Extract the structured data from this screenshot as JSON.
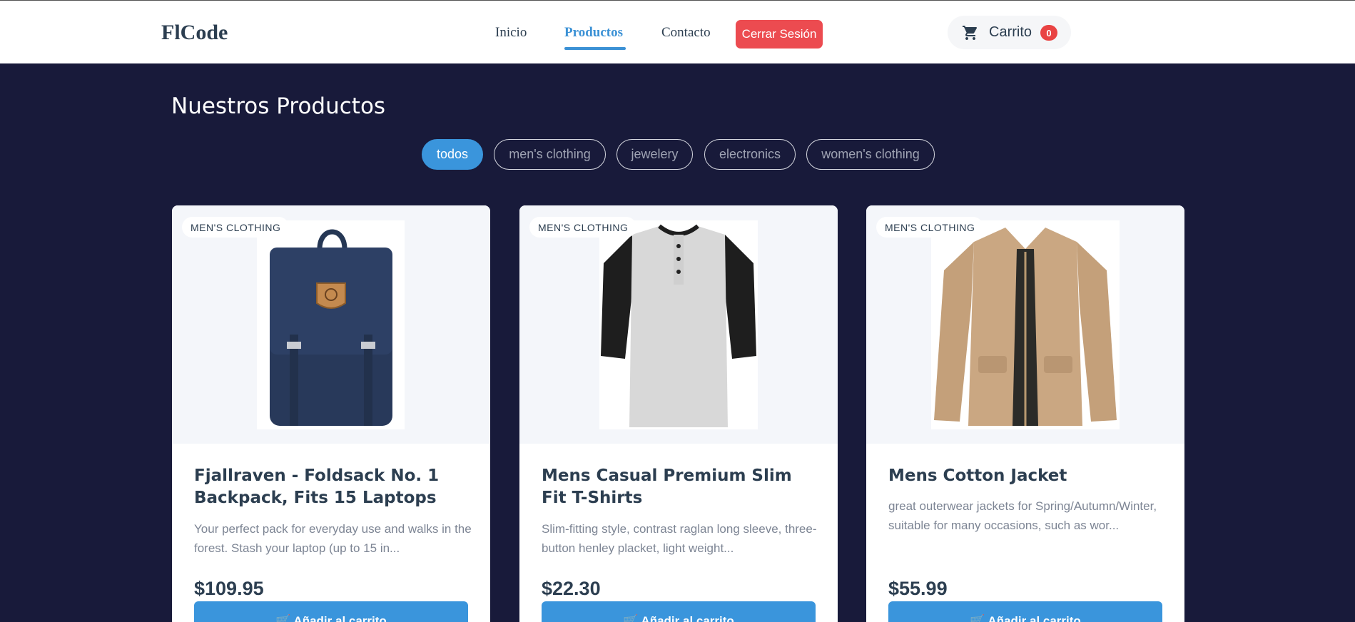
{
  "header": {
    "logo": "FlCode",
    "nav": [
      {
        "label": "Inicio",
        "active": false
      },
      {
        "label": "Productos",
        "active": true
      },
      {
        "label": "Contacto",
        "active": false
      }
    ],
    "logout_label": "Cerrar Sesión",
    "cart": {
      "label": "Carrito",
      "count": "0",
      "icon": "shopping-cart-icon"
    }
  },
  "main": {
    "title": "Nuestros Productos",
    "filters": [
      {
        "label": "todos",
        "active": true
      },
      {
        "label": "men's clothing",
        "active": false
      },
      {
        "label": "jewelery",
        "active": false
      },
      {
        "label": "electronics",
        "active": false
      },
      {
        "label": "women's clothing",
        "active": false
      }
    ]
  },
  "products": [
    {
      "category": "MEN'S CLOTHING",
      "title": "Fjallraven - Foldsack No. 1 Backpack, Fits 15 Laptops",
      "description": "Your perfect pack for everyday use and walks in the forest. Stash your laptop (up to 15 in...",
      "price": "$109.95",
      "button_label": "🛒 Añadir al carrito",
      "image": "navy-backpack"
    },
    {
      "category": "MEN'S CLOTHING",
      "title": "Mens Casual Premium Slim Fit T-Shirts",
      "description": "Slim-fitting style, contrast raglan long sleeve, three-button henley placket, light weight...",
      "price": "$22.30",
      "button_label": "🛒 Añadir al carrito",
      "image": "raglan-henley-shirt"
    },
    {
      "category": "MEN'S CLOTHING",
      "title": "Mens Cotton Jacket",
      "description": "great outerwear jackets for Spring/Autumn/Winter, suitable for many occasions, such as wor...",
      "price": "$55.99",
      "button_label": "🛒 Añadir al carrito",
      "image": "khaki-cotton-jacket"
    }
  ],
  "colors": {
    "background": "#181a3a",
    "accent": "#3a95dc",
    "logout": "#ec4b50",
    "badge": "#e94343"
  }
}
